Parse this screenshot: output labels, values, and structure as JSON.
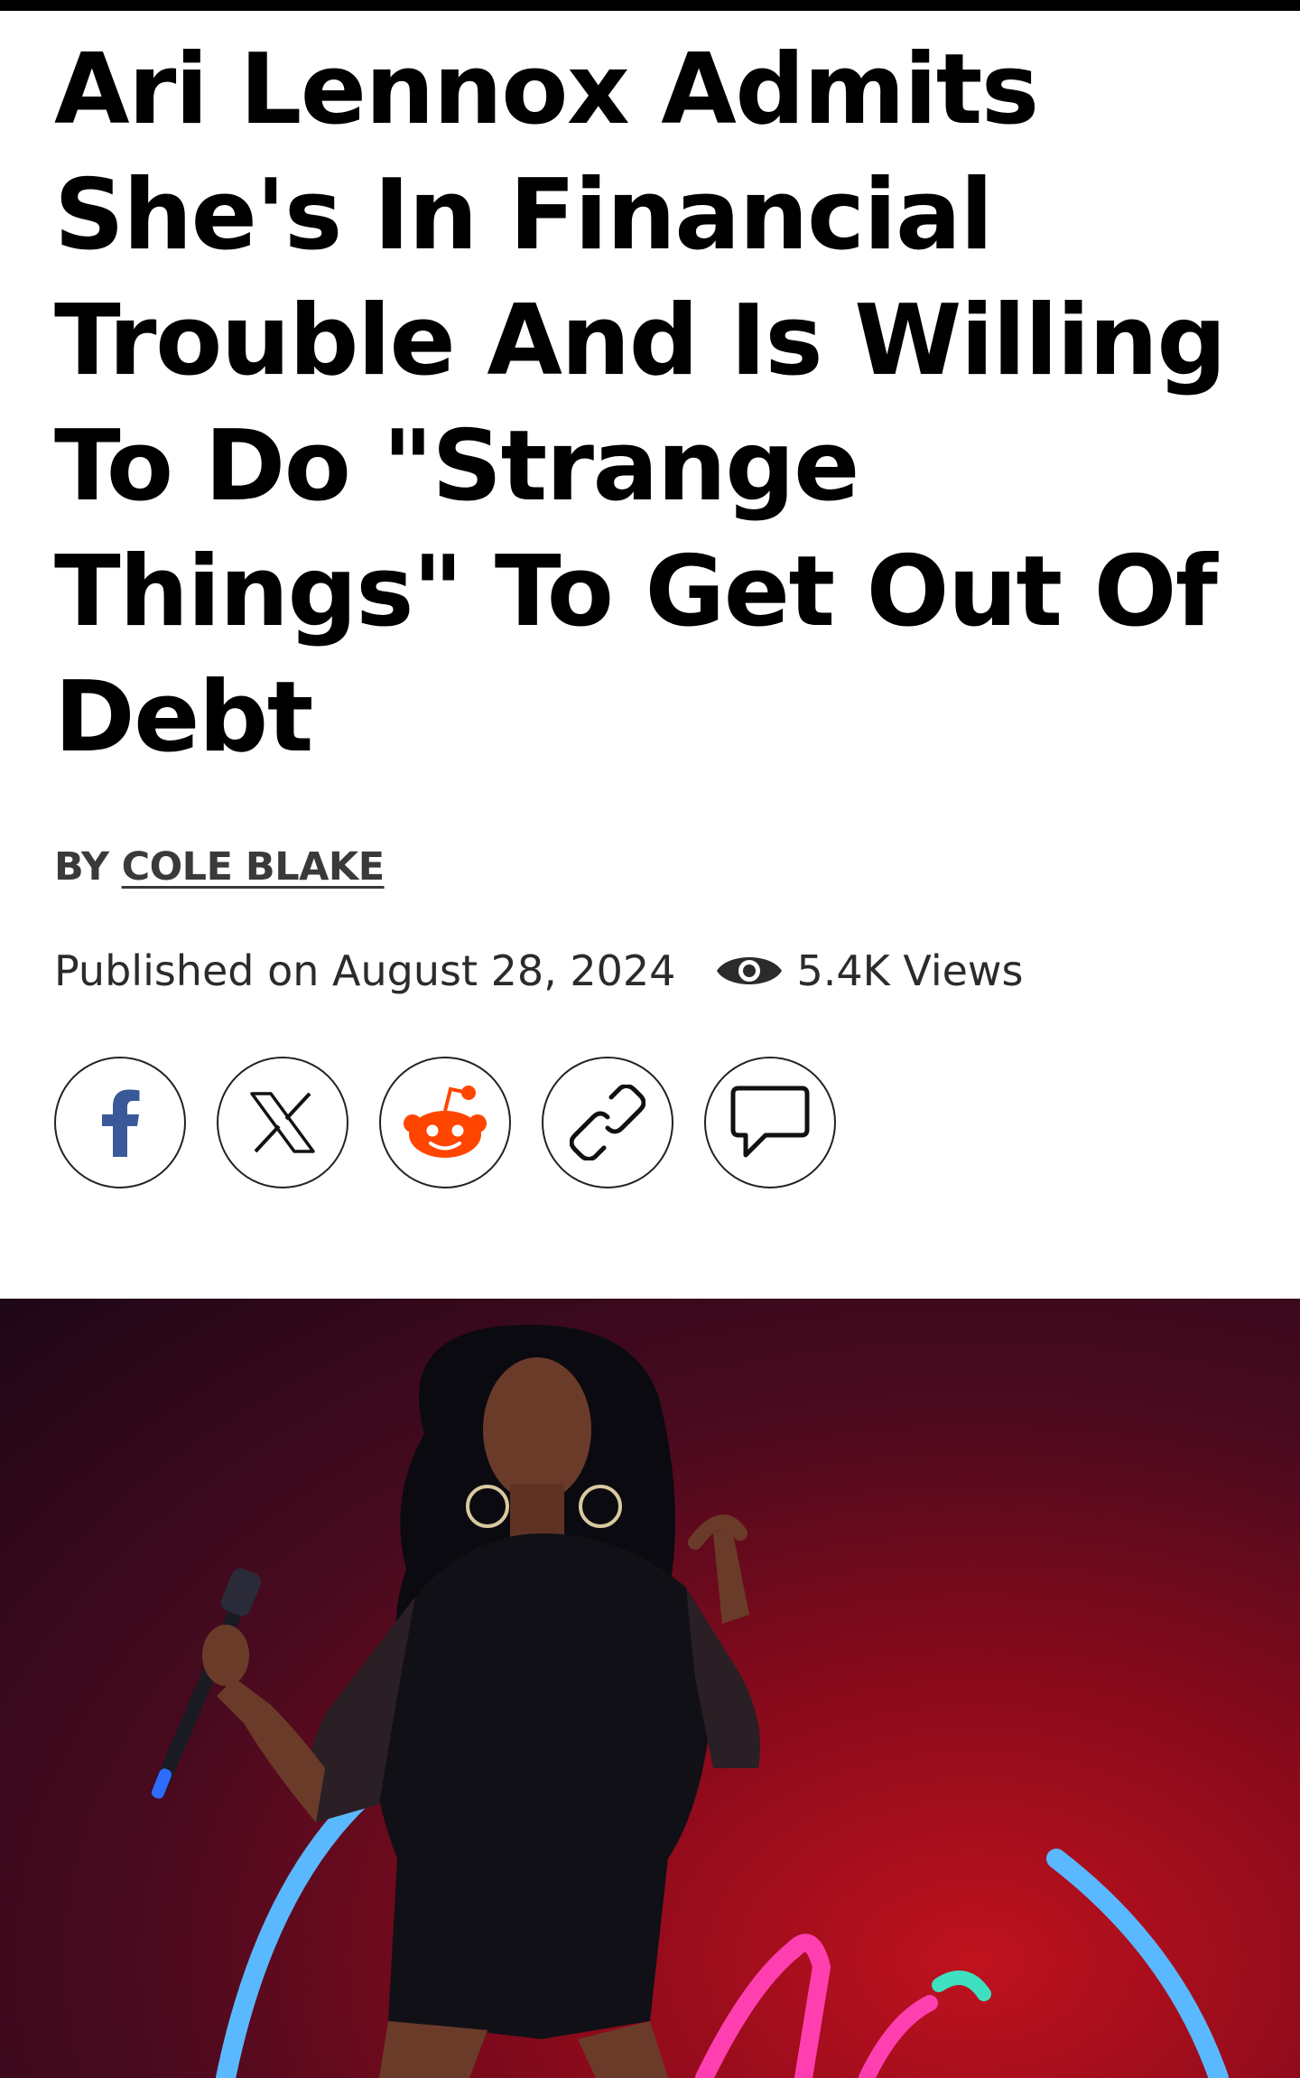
{
  "article": {
    "headline": "Ari Lennox Admits She's In Financial Trouble And Is Willing To Do \"Strange Things\" To Get Out Of Debt",
    "byline_prefix": "BY",
    "author": "COLE BLAKE",
    "published": "Published on August 28, 2024",
    "views": "5.4K Views"
  },
  "share": {
    "buttons": [
      {
        "name": "facebook",
        "icon": "facebook-icon"
      },
      {
        "name": "x",
        "icon": "x-icon"
      },
      {
        "name": "reddit",
        "icon": "reddit-icon"
      },
      {
        "name": "copy-link",
        "icon": "link-icon"
      },
      {
        "name": "comments",
        "icon": "comment-icon"
      }
    ]
  },
  "colors": {
    "facebook": "#3b5998",
    "reddit": "#ff4500",
    "hero_background": "#8a0a1b",
    "neon_blue": "#5ab8ff",
    "neon_pink": "#ff3fb0"
  },
  "hero_image": {
    "description_icon": "performer-photo"
  }
}
